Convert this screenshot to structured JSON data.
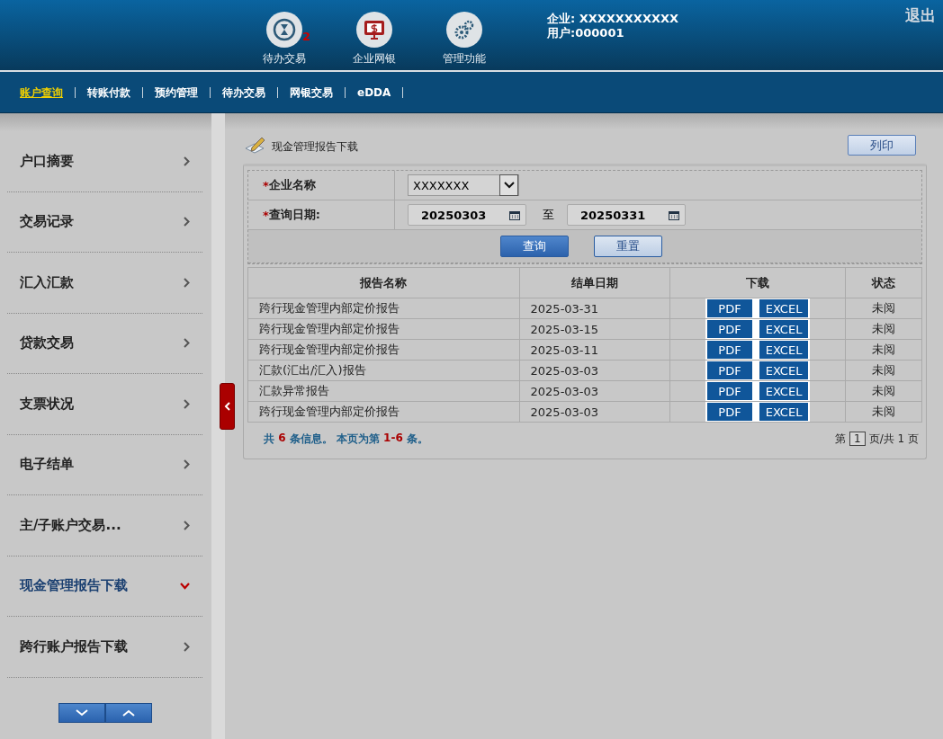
{
  "header": {
    "apps": [
      {
        "label": "待办交易",
        "kind": "pending",
        "badge": "2"
      },
      {
        "label": "企业网银",
        "kind": "bank"
      },
      {
        "label": "管理功能",
        "kind": "settings"
      }
    ],
    "company": "企业: XXXXXXXXXXX",
    "user": "用户:000001",
    "logout": "退出"
  },
  "nav": [
    {
      "label": "账户查询",
      "selected": true
    },
    {
      "label": "转账付款",
      "selected": false
    },
    {
      "label": "预约管理",
      "selected": false
    },
    {
      "label": "待办交易",
      "selected": false
    },
    {
      "label": "网银交易",
      "selected": false
    },
    {
      "label": "eDDA",
      "selected": false
    }
  ],
  "sidebar": {
    "items": [
      {
        "label": "户口摘要",
        "selected": false
      },
      {
        "label": "交易记录",
        "selected": false
      },
      {
        "label": "汇入汇款",
        "selected": false
      },
      {
        "label": "贷款交易",
        "selected": false
      },
      {
        "label": "支票状况",
        "selected": false
      },
      {
        "label": "电子结单",
        "selected": false
      },
      {
        "label": "主/子账户交易...",
        "selected": false
      },
      {
        "label": "现金管理报告下载",
        "selected": true
      },
      {
        "label": "跨行账户报告下载",
        "selected": false
      }
    ]
  },
  "page": {
    "title": "现金管理报告下载",
    "print_button": "列印"
  },
  "form": {
    "company_label": "*企业名称",
    "company_value": "XXXXXXX",
    "date_label": "*查询日期:",
    "date_from": "20250303",
    "date_sep": "至",
    "date_to": "20250331",
    "query_button": "查询",
    "reset_button": "重置"
  },
  "table": {
    "columns": [
      "报告名称",
      "结单日期",
      "下载",
      "状态"
    ],
    "rows": [
      {
        "name": "跨行现金管理内部定价报告",
        "date": "2025-03-31",
        "downloads": [
          "PDF",
          "EXCEL"
        ],
        "status": "未阅"
      },
      {
        "name": "跨行现金管理内部定价报告",
        "date": "2025-03-15",
        "downloads": [
          "PDF",
          "EXCEL"
        ],
        "status": "未阅"
      },
      {
        "name": "跨行现金管理内部定价报告",
        "date": "2025-03-11",
        "downloads": [
          "PDF",
          "EXCEL"
        ],
        "status": "未阅"
      },
      {
        "name": "汇款(汇出/汇入)报告",
        "date": "2025-03-03",
        "downloads": [
          "PDF",
          "EXCEL"
        ],
        "status": "未阅"
      },
      {
        "name": "汇款异常报告",
        "date": "2025-03-03",
        "downloads": [
          "PDF",
          "EXCEL"
        ],
        "status": "未阅"
      },
      {
        "name": "跨行现金管理内部定价报告",
        "date": "2025-03-03",
        "downloads": [
          "PDF",
          "EXCEL"
        ],
        "status": "未阅"
      }
    ]
  },
  "footer": {
    "summary": [
      {
        "text": "共 ",
        "highlight": false
      },
      {
        "text": "6",
        "highlight": true
      },
      {
        "text": " 条信息。 本页为第 ",
        "highlight": false
      },
      {
        "text": "1-6",
        "highlight": true
      },
      {
        "text": " 条。",
        "highlight": false
      }
    ],
    "page_prefix": "第",
    "page_value": "1",
    "page_suffix": "页/共 1 页"
  }
}
